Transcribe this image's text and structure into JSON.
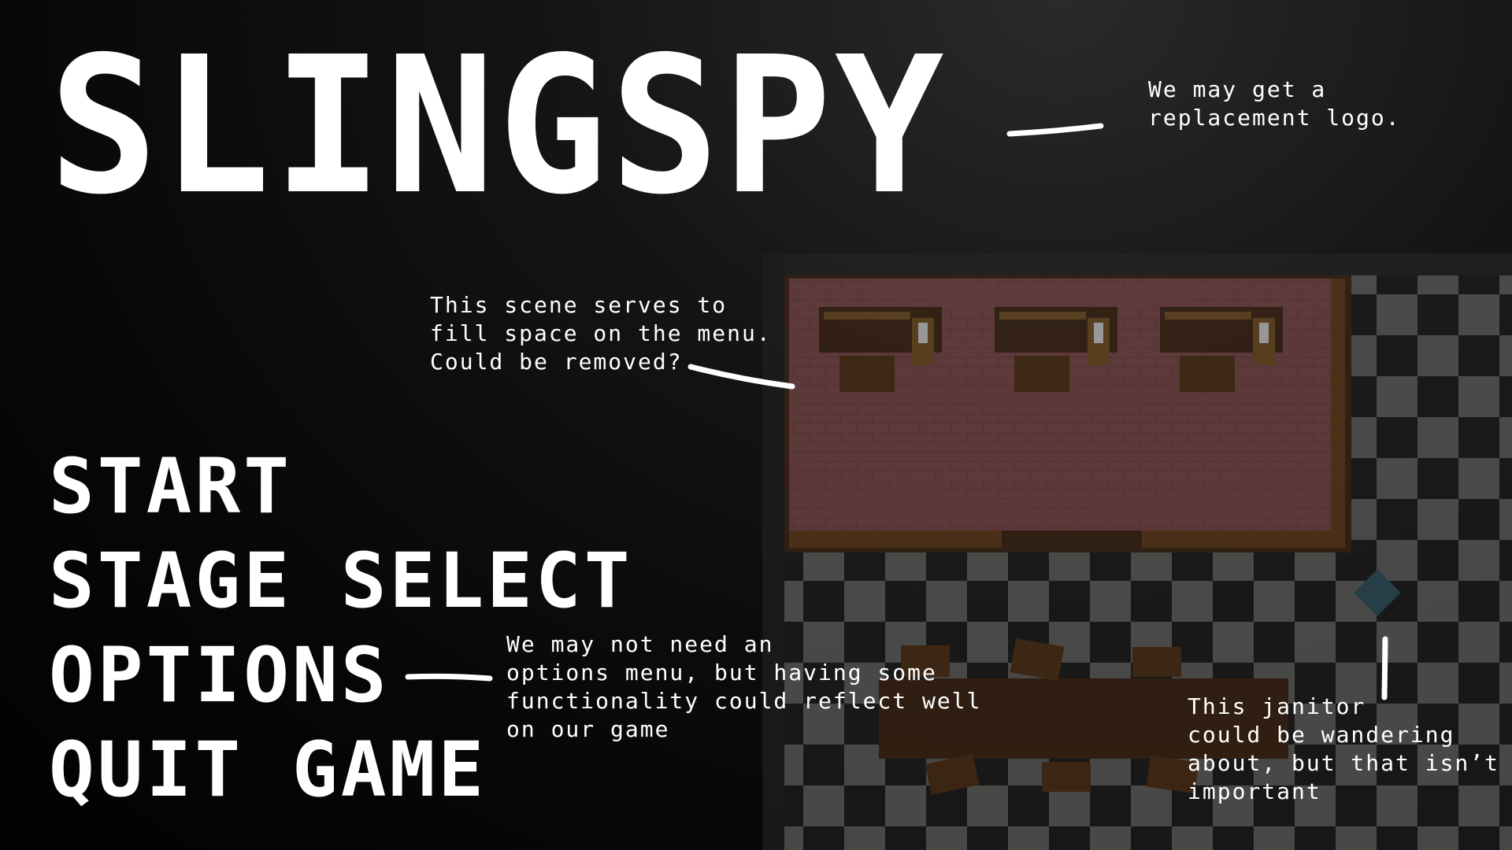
{
  "game": {
    "title": "SLINGSPY"
  },
  "menu": {
    "items": [
      {
        "label": "START"
      },
      {
        "label": "STAGE SELECT"
      },
      {
        "label": "OPTIONS"
      },
      {
        "label": "QUIT GAME"
      }
    ]
  },
  "annotations": {
    "logo_note": "We may get a\nreplacement logo.",
    "scene_note": "This scene serves to\nfill space on the menu.\nCould be removed?",
    "options_note": "We may not need an\noptions menu, but having some\nfunctionality could reflect well\non our game",
    "janitor_note": "This janitor\ncould be wandering\nabout, but that isn’t\nimportant"
  },
  "colors": {
    "carpet": "#6b3e40",
    "wood": "#3a2414",
    "checker_light": "#5a5a58",
    "checker_dark": "#1c1c1c",
    "janitor": "#2f4c5a"
  }
}
